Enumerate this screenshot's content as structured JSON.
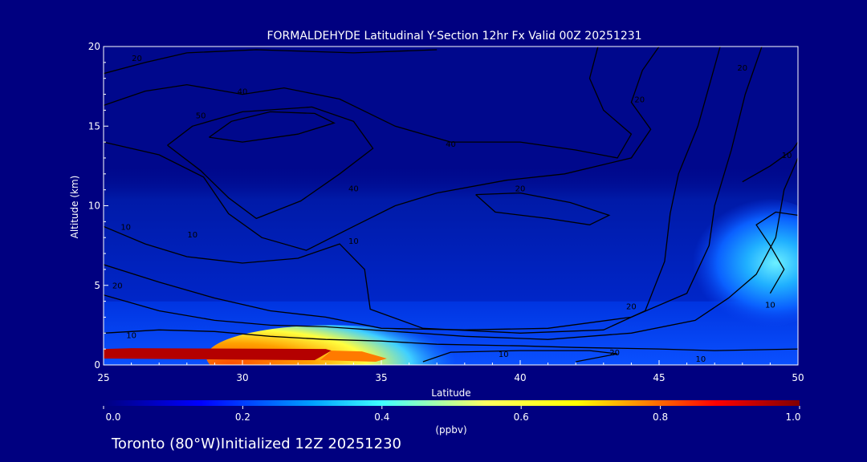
{
  "chart_data": {
    "type": "heatmap",
    "title": "FORMALDEHYDE Latitudinal Y-Section 12hr  Fx Valid 00Z 20251231",
    "xlabel": "Latitude",
    "ylabel": "Altitude (km)",
    "xlim": [
      25,
      50
    ],
    "ylim": [
      0,
      20
    ],
    "xticks": [
      "25",
      "30",
      "35",
      "40",
      "45",
      "50"
    ],
    "yticks": [
      "0",
      "5",
      "10",
      "15",
      "20"
    ],
    "colorbar": {
      "label": "(ppbv)",
      "range": [
        0.0,
        1.0
      ],
      "ticks": [
        "0.0",
        "0.2",
        "0.4",
        "0.6",
        "0.8",
        "1.0"
      ],
      "colors": [
        "#000080",
        "#0000ff",
        "#00a0ff",
        "#40ffff",
        "#ffff00",
        "#ff8000",
        "#ff0000",
        "#800000"
      ]
    },
    "concentration_regions": [
      {
        "lat": [
          25,
          33
        ],
        "alt": [
          0.4,
          1.0
        ],
        "value": 1.0
      },
      {
        "lat": [
          33,
          35
        ],
        "alt": [
          0.3,
          1.0
        ],
        "value": 0.75
      },
      {
        "lat": [
          35,
          36.5
        ],
        "alt": [
          0.3,
          0.9
        ],
        "value": 0.4
      },
      {
        "lat": [
          47,
          50
        ],
        "alt": [
          5.5,
          7.5
        ],
        "value": 0.3
      },
      {
        "lat": [
          25,
          50
        ],
        "alt": [
          0,
          4
        ],
        "value": 0.18
      },
      {
        "lat": [
          25,
          50
        ],
        "alt": [
          4,
          11
        ],
        "value": 0.12
      }
    ],
    "contour_labels": [
      {
        "text": "20",
        "lat": 26.2,
        "alt": 19.1
      },
      {
        "text": "40",
        "lat": 30.0,
        "alt": 17.0
      },
      {
        "text": "50",
        "lat": 28.5,
        "alt": 15.5
      },
      {
        "text": "40",
        "lat": 37.5,
        "alt": 13.7
      },
      {
        "text": "40",
        "lat": 34.0,
        "alt": 10.9
      },
      {
        "text": "20",
        "lat": 40.0,
        "alt": 10.9
      },
      {
        "text": "20",
        "lat": 44.3,
        "alt": 16.5
      },
      {
        "text": "20",
        "lat": 48.0,
        "alt": 18.5
      },
      {
        "text": "10",
        "lat": 49.6,
        "alt": 13.0
      },
      {
        "text": "10",
        "lat": 25.8,
        "alt": 8.5
      },
      {
        "text": "10",
        "lat": 28.2,
        "alt": 8.0
      },
      {
        "text": "10",
        "lat": 34.0,
        "alt": 7.6
      },
      {
        "text": "20",
        "lat": 25.5,
        "alt": 4.8
      },
      {
        "text": "10",
        "lat": 26.0,
        "alt": 1.7
      },
      {
        "text": "10",
        "lat": 39.4,
        "alt": 0.5
      },
      {
        "text": "20",
        "lat": 44.0,
        "alt": 3.5
      },
      {
        "text": "20",
        "lat": 43.4,
        "alt": 0.6
      },
      {
        "text": "10",
        "lat": 46.5,
        "alt": 0.2
      },
      {
        "text": "10",
        "lat": 49.0,
        "alt": 3.6
      }
    ],
    "contours": [
      [
        [
          25,
          18.3
        ],
        [
          26.5,
          19
        ],
        [
          28,
          19.6
        ],
        [
          30.5,
          19.8
        ],
        [
          34,
          19.6
        ],
        [
          37,
          19.8
        ]
      ],
      [
        [
          25,
          16.3
        ],
        [
          26.5,
          17.2
        ],
        [
          28,
          17.6
        ],
        [
          30,
          17
        ],
        [
          31.5,
          17.4
        ],
        [
          33.5,
          16.7
        ],
        [
          35.5,
          15
        ],
        [
          37.5,
          14
        ],
        [
          40,
          14
        ],
        [
          42,
          13.5
        ],
        [
          43.5,
          13
        ],
        [
          44,
          14.5
        ],
        [
          43,
          16
        ],
        [
          42.5,
          18
        ],
        [
          42.8,
          20
        ]
      ],
      [
        [
          28.8,
          14.3
        ],
        [
          29.6,
          15.3
        ],
        [
          31,
          15.9
        ],
        [
          32.6,
          15.8
        ],
        [
          33.3,
          15.2
        ],
        [
          32,
          14.5
        ],
        [
          30,
          14
        ],
        [
          28.8,
          14.3
        ]
      ],
      [
        [
          27.3,
          13.8
        ],
        [
          28.2,
          15
        ],
        [
          30,
          15.9
        ],
        [
          32.5,
          16.2
        ],
        [
          34,
          15.3
        ],
        [
          34.7,
          13.6
        ],
        [
          33.5,
          12
        ],
        [
          32.1,
          10.3
        ],
        [
          30.5,
          9.2
        ],
        [
          29.5,
          10.5
        ],
        [
          28.5,
          12.2
        ],
        [
          27.3,
          13.8
        ]
      ],
      [
        [
          25,
          14
        ],
        [
          27,
          13.2
        ],
        [
          28.6,
          11.8
        ],
        [
          29.5,
          9.5
        ],
        [
          30.7,
          8
        ],
        [
          32.3,
          7.2
        ],
        [
          34,
          8.7
        ],
        [
          35.5,
          10
        ],
        [
          37,
          10.8
        ],
        [
          39.5,
          11.6
        ],
        [
          41.6,
          12
        ],
        [
          44,
          13
        ],
        [
          44.7,
          14.8
        ],
        [
          44,
          16.5
        ],
        [
          44.4,
          18.5
        ],
        [
          45,
          20
        ]
      ],
      [
        [
          38.4,
          10.7
        ],
        [
          39.1,
          9.6
        ],
        [
          41,
          9.2
        ],
        [
          42.5,
          8.8
        ],
        [
          43.2,
          9.4
        ],
        [
          41.8,
          10.2
        ],
        [
          40,
          10.8
        ],
        [
          38.4,
          10.7
        ]
      ],
      [
        [
          25,
          8.7
        ],
        [
          26.5,
          7.6
        ],
        [
          28,
          6.8
        ],
        [
          30,
          6.4
        ],
        [
          32,
          6.7
        ],
        [
          33.5,
          7.6
        ],
        [
          34.4,
          6
        ],
        [
          34.6,
          3.5
        ],
        [
          36.5,
          2.3
        ],
        [
          40,
          2
        ],
        [
          43,
          2.2
        ],
        [
          44.5,
          3.4
        ],
        [
          45.2,
          6.5
        ],
        [
          45.4,
          9.5
        ],
        [
          45.7,
          12
        ],
        [
          46.4,
          15
        ],
        [
          46.8,
          17.5
        ],
        [
          47.2,
          20
        ]
      ],
      [
        [
          25,
          6.3
        ],
        [
          27,
          5.2
        ],
        [
          29,
          4.2
        ],
        [
          31,
          3.4
        ],
        [
          33,
          3
        ],
        [
          35,
          2.3
        ],
        [
          38,
          2.2
        ],
        [
          41,
          2.3
        ],
        [
          44,
          3
        ],
        [
          46,
          4.5
        ],
        [
          46.8,
          7.5
        ],
        [
          47,
          10
        ],
        [
          47.6,
          13.5
        ],
        [
          48.1,
          17
        ],
        [
          48.7,
          20
        ]
      ],
      [
        [
          25,
          4.4
        ],
        [
          27,
          3.4
        ],
        [
          29,
          2.8
        ],
        [
          31,
          2.5
        ],
        [
          33,
          2.4
        ],
        [
          35.5,
          2.1
        ],
        [
          38,
          1.8
        ],
        [
          41,
          1.6
        ],
        [
          44,
          2
        ],
        [
          46.3,
          2.8
        ],
        [
          47.5,
          4.2
        ],
        [
          48.5,
          5.7
        ],
        [
          49.2,
          8
        ],
        [
          49.5,
          11
        ],
        [
          50,
          13
        ]
      ],
      [
        [
          25,
          2
        ],
        [
          27,
          2.2
        ],
        [
          29,
          2.1
        ],
        [
          31,
          1.8
        ],
        [
          33,
          1.6
        ],
        [
          35,
          1.5
        ],
        [
          37,
          1.3
        ],
        [
          40,
          1.2
        ],
        [
          42,
          1.1
        ],
        [
          45,
          1.0
        ],
        [
          47,
          0.9
        ],
        [
          50,
          1.0
        ]
      ],
      [
        [
          36.5,
          0.2
        ],
        [
          37.5,
          0.8
        ],
        [
          40,
          0.9
        ],
        [
          42.5,
          0.9
        ],
        [
          43.5,
          0.7
        ],
        [
          42,
          0.2
        ]
      ],
      [
        [
          49,
          4.5
        ],
        [
          49.5,
          6
        ],
        [
          49,
          7.5
        ],
        [
          48.5,
          8.8
        ],
        [
          49.2,
          9.6
        ],
        [
          50,
          9.4
        ]
      ],
      [
        [
          48,
          11.5
        ],
        [
          49,
          12.5
        ],
        [
          49.8,
          13.5
        ],
        [
          50,
          14
        ]
      ]
    ]
  },
  "footer": {
    "text": "Toronto (80°W)Initialized 12Z 20251230"
  }
}
